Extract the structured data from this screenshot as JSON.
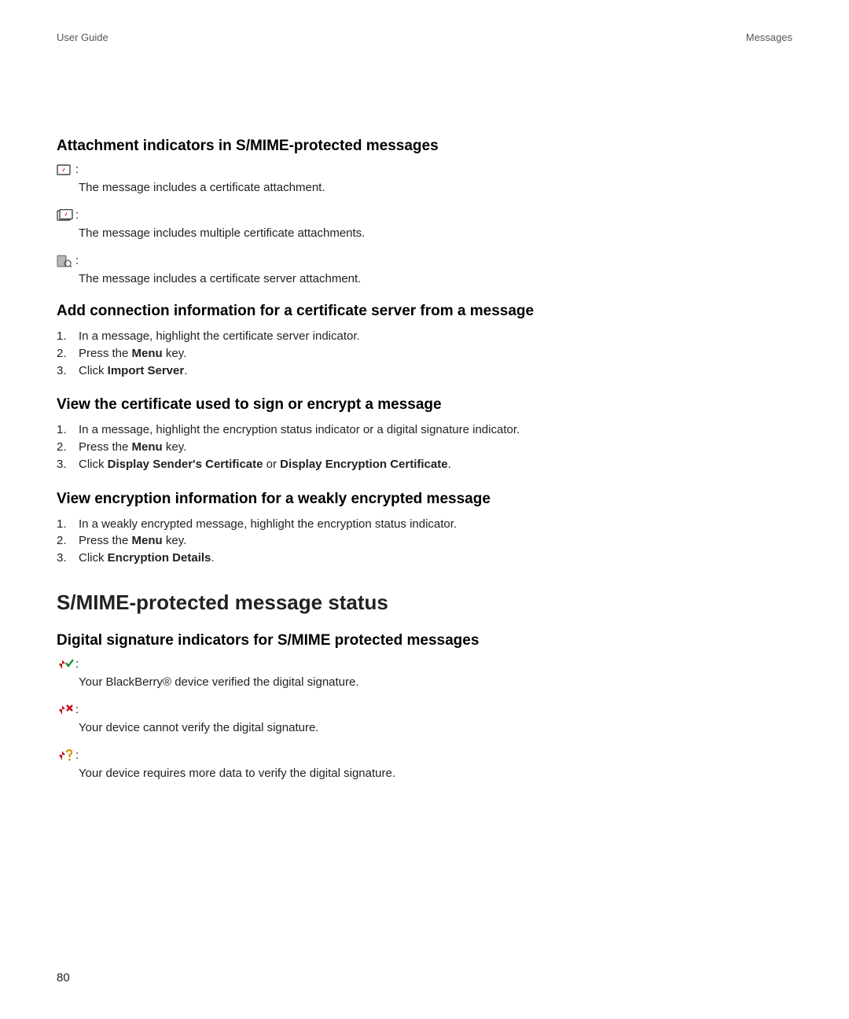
{
  "header": {
    "left": "User Guide",
    "right": "Messages"
  },
  "s1": {
    "title": "Attachment indicators in S/MIME-protected messages",
    "items": [
      {
        "icon": "cert-single-icon",
        "desc": "The message includes a certificate attachment."
      },
      {
        "icon": "cert-multi-icon",
        "desc": "The message includes multiple certificate attachments."
      },
      {
        "icon": "cert-server-icon",
        "desc": "The message includes a certificate server attachment."
      }
    ]
  },
  "s2": {
    "title": "Add connection information for a certificate server from a message",
    "steps": [
      {
        "n": "1.",
        "pre": "In a message, highlight the certificate server indicator."
      },
      {
        "n": "2.",
        "pre": "Press the ",
        "bold": "Menu",
        "post": " key."
      },
      {
        "n": "3.",
        "pre": "Click ",
        "bold": "Import Server",
        "post": "."
      }
    ]
  },
  "s3": {
    "title": "View the certificate used to sign or encrypt a message",
    "steps": [
      {
        "n": "1.",
        "pre": "In a message, highlight the encryption status indicator or a digital signature indicator."
      },
      {
        "n": "2.",
        "pre": "Press the ",
        "bold": "Menu",
        "post": " key."
      },
      {
        "n": "3.",
        "pre": "Click ",
        "bold": "Display Sender's Certificate",
        "post": " or ",
        "bold2": "Display Encryption Certificate",
        "post2": "."
      }
    ]
  },
  "s4": {
    "title": "View encryption information for a weakly encrypted message",
    "steps": [
      {
        "n": "1.",
        "pre": "In a weakly encrypted message, highlight the encryption status indicator."
      },
      {
        "n": "2.",
        "pre": "Press the ",
        "bold": "Menu",
        "post": " key."
      },
      {
        "n": "3.",
        "pre": "Click ",
        "bold": "Encryption Details",
        "post": "."
      }
    ]
  },
  "major": "S/MIME-protected message status",
  "s5": {
    "title": "Digital signature indicators for S/MIME protected messages",
    "items": [
      {
        "icon": "sig-verified-icon",
        "desc": "Your BlackBerry® device verified the digital signature."
      },
      {
        "icon": "sig-failed-icon",
        "desc": "Your device cannot verify the digital signature."
      },
      {
        "icon": "sig-more-data-icon",
        "desc": "Your device requires more data to verify the digital signature."
      }
    ]
  },
  "pageNumber": "80",
  "colon": ":"
}
